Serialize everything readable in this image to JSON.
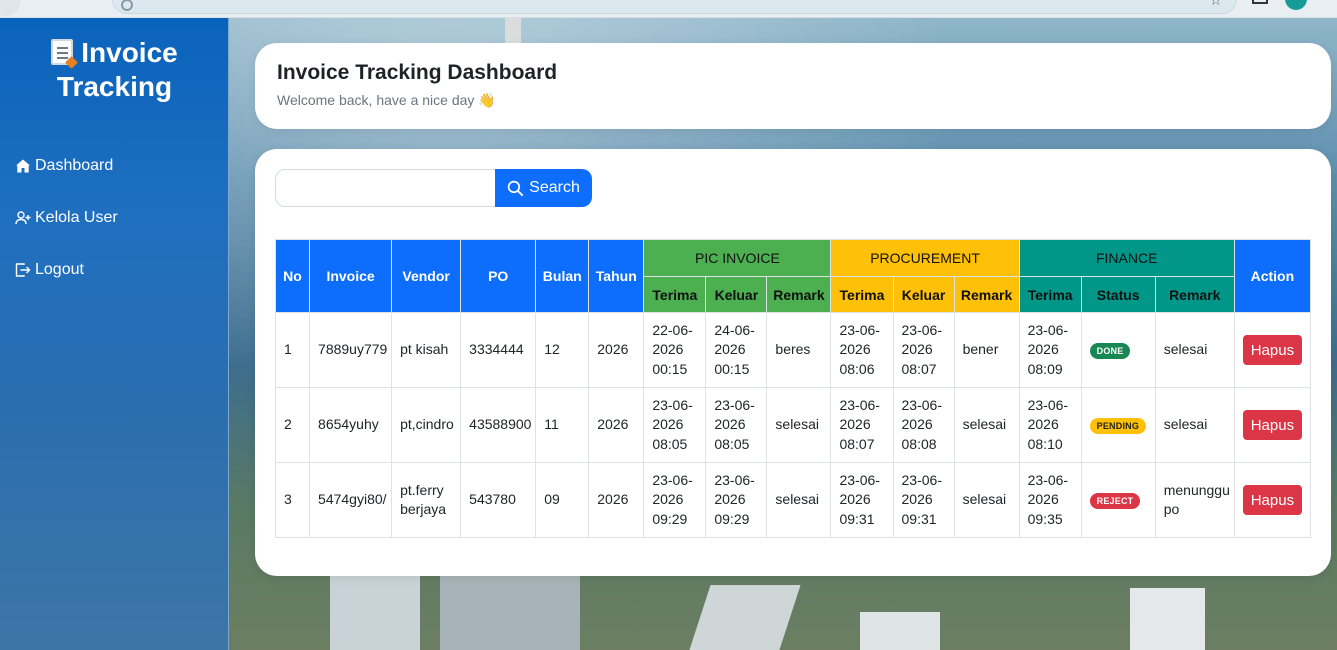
{
  "app": {
    "brand_line1": "Invoice",
    "brand_line2": "Tracking"
  },
  "sidebar": {
    "items": [
      {
        "label": "Dashboard",
        "icon": "home-icon"
      },
      {
        "label": "Kelola User",
        "icon": "user-plus-icon"
      },
      {
        "label": "Logout",
        "icon": "logout-icon"
      }
    ]
  },
  "header": {
    "title": "Invoice Tracking Dashboard",
    "subtitle": "Welcome back, have a nice day 👋"
  },
  "search": {
    "value": "",
    "button_label": "Search"
  },
  "table": {
    "headers": {
      "no": "No",
      "invoice": "Invoice",
      "vendor": "Vendor",
      "po": "PO",
      "bulan": "Bulan",
      "tahun": "Tahun",
      "pic_invoice": "PIC INVOICE",
      "procurement": "PROCUREMENT",
      "finance": "FINANCE",
      "action": "Action",
      "terima": "Terima",
      "keluar": "Keluar",
      "remark": "Remark",
      "status": "Status"
    },
    "rows": [
      {
        "no": "1",
        "invoice": "7889uy779",
        "vendor": "pt kisah",
        "po": "3334444",
        "bulan": "12",
        "tahun": "2026",
        "pic_terima": "22-06-2026 00:15",
        "pic_keluar": "24-06-2026 00:15",
        "pic_remark": "beres",
        "proc_terima": "23-06-2026 08:06",
        "proc_keluar": "23-06-2026 08:07",
        "proc_remark": "bener",
        "fin_terima": "23-06-2026 08:09",
        "fin_status": "DONE",
        "fin_remark": "selesai",
        "action": "Hapus"
      },
      {
        "no": "2",
        "invoice": "8654yuhy",
        "vendor": "pt,cindro",
        "po": "43588900",
        "bulan": "11",
        "tahun": "2026",
        "pic_terima": "23-06-2026 08:05",
        "pic_keluar": "23-06-2026 08:05",
        "pic_remark": "selesai",
        "proc_terima": "23-06-2026 08:07",
        "proc_keluar": "23-06-2026 08:08",
        "proc_remark": "selesai",
        "fin_terima": "23-06-2026 08:10",
        "fin_status": "PENDING",
        "fin_remark": "selesai",
        "action": "Hapus"
      },
      {
        "no": "3",
        "invoice": "5474gyi80/",
        "vendor": "pt.ferry berjaya",
        "po": "543780",
        "bulan": "09",
        "tahun": "2026",
        "pic_terima": "23-06-2026 09:29",
        "pic_keluar": "23-06-2026 09:29",
        "pic_remark": "selesai",
        "proc_terima": "23-06-2026 09:31",
        "proc_keluar": "23-06-2026 09:31",
        "proc_remark": "selesai",
        "fin_terima": "23-06-2026 09:35",
        "fin_status": "REJECT",
        "fin_remark": "menunggu po",
        "action": "Hapus"
      }
    ]
  },
  "colors": {
    "primary": "#0d6efd",
    "pic_green": "#4caf50",
    "procurement_yellow": "#ffc107",
    "finance_teal": "#009688",
    "danger": "#dc3545",
    "success": "#198754"
  }
}
